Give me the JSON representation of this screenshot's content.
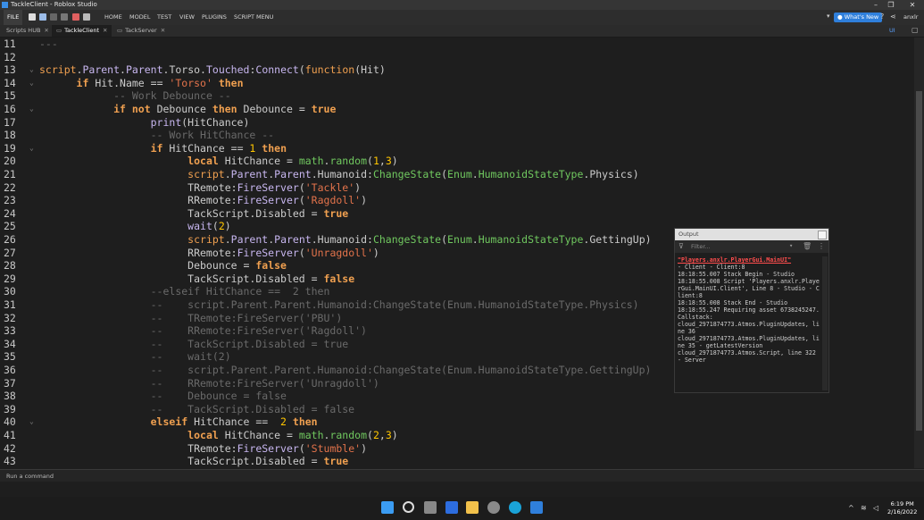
{
  "window": {
    "title": "TackleClient - Roblox Studio"
  },
  "menu": {
    "file": "FILE",
    "items": [
      "HOME",
      "MODEL",
      "TEST",
      "VIEW",
      "PLUGINS",
      "SCRIPT MENU"
    ],
    "whats_new": "What's New",
    "user": "anxlr"
  },
  "tabs": [
    {
      "label": "Scripts HUB",
      "active": false
    },
    {
      "label": "TackleClient",
      "active": true
    },
    {
      "label": "TackServer",
      "active": false
    }
  ],
  "editor": {
    "lines": [
      {
        "n": "11",
        "fold": false,
        "t": [
          [
            "com",
            "---"
          ]
        ]
      },
      {
        "n": "12",
        "fold": false,
        "t": []
      },
      {
        "n": "13",
        "fold": true,
        "t": [
          [
            "kw2",
            "script"
          ],
          [
            "def",
            "."
          ],
          [
            "call",
            "Parent"
          ],
          [
            "def",
            "."
          ],
          [
            "call",
            "Parent"
          ],
          [
            "def",
            ".Torso."
          ],
          [
            "call",
            "Touched"
          ],
          [
            "def",
            ":"
          ],
          [
            "call",
            "Connect"
          ],
          [
            "def",
            "("
          ],
          [
            "kw2",
            "function"
          ],
          [
            "def",
            "(Hit)"
          ]
        ]
      },
      {
        "n": "14",
        "fold": true,
        "t": [
          [
            "def",
            "      "
          ],
          [
            "kw",
            "if"
          ],
          [
            "def",
            " Hit.Name == "
          ],
          [
            "str",
            "'Torso'"
          ],
          [
            "def",
            " "
          ],
          [
            "kw",
            "then"
          ]
        ]
      },
      {
        "n": "15",
        "fold": false,
        "t": [
          [
            "def",
            "            "
          ],
          [
            "com",
            "-- Work Debounce --"
          ]
        ]
      },
      {
        "n": "16",
        "fold": true,
        "t": [
          [
            "def",
            "            "
          ],
          [
            "kw",
            "if not"
          ],
          [
            "def",
            " Debounce "
          ],
          [
            "kw",
            "then"
          ],
          [
            "def",
            " Debounce = "
          ],
          [
            "kw",
            "true"
          ]
        ]
      },
      {
        "n": "17",
        "fold": false,
        "t": [
          [
            "def",
            "                  "
          ],
          [
            "call",
            "print"
          ],
          [
            "def",
            "(HitChance)"
          ]
        ]
      },
      {
        "n": "18",
        "fold": false,
        "t": [
          [
            "def",
            "                  "
          ],
          [
            "com",
            "-- Work HitChance --"
          ]
        ]
      },
      {
        "n": "19",
        "fold": true,
        "t": [
          [
            "def",
            "                  "
          ],
          [
            "kw",
            "if"
          ],
          [
            "def",
            " HitChance == "
          ],
          [
            "num",
            "1"
          ],
          [
            "def",
            " "
          ],
          [
            "kw",
            "then"
          ]
        ]
      },
      {
        "n": "20",
        "fold": false,
        "t": [
          [
            "def",
            "                        "
          ],
          [
            "kw",
            "local"
          ],
          [
            "def",
            " HitChance = "
          ],
          [
            "lib",
            "math"
          ],
          [
            "def",
            "."
          ],
          [
            "lib",
            "random"
          ],
          [
            "def",
            "("
          ],
          [
            "num",
            "1"
          ],
          [
            "def",
            ","
          ],
          [
            "num",
            "3"
          ],
          [
            "def",
            ")"
          ]
        ]
      },
      {
        "n": "21",
        "fold": false,
        "t": [
          [
            "def",
            "                        "
          ],
          [
            "kw2",
            "script"
          ],
          [
            "def",
            "."
          ],
          [
            "call",
            "Parent"
          ],
          [
            "def",
            "."
          ],
          [
            "call",
            "Parent"
          ],
          [
            "def",
            ".Humanoid:"
          ],
          [
            "lib",
            "ChangeState"
          ],
          [
            "def",
            "("
          ],
          [
            "lib",
            "Enum"
          ],
          [
            "def",
            "."
          ],
          [
            "lib",
            "HumanoidStateType"
          ],
          [
            "def",
            ".Physics)"
          ]
        ]
      },
      {
        "n": "22",
        "fold": false,
        "t": [
          [
            "def",
            "                        TRemote:"
          ],
          [
            "call",
            "FireServer"
          ],
          [
            "def",
            "("
          ],
          [
            "str",
            "'Tackle'"
          ],
          [
            "def",
            ")"
          ]
        ]
      },
      {
        "n": "23",
        "fold": false,
        "t": [
          [
            "def",
            "                        RRemote:"
          ],
          [
            "call",
            "FireServer"
          ],
          [
            "def",
            "("
          ],
          [
            "str",
            "'Ragdoll'"
          ],
          [
            "def",
            ")"
          ]
        ]
      },
      {
        "n": "24",
        "fold": false,
        "t": [
          [
            "def",
            "                        TackScript.Disabled = "
          ],
          [
            "kw",
            "true"
          ]
        ]
      },
      {
        "n": "25",
        "fold": false,
        "t": [
          [
            "def",
            "                        "
          ],
          [
            "call",
            "wait"
          ],
          [
            "def",
            "("
          ],
          [
            "num",
            "2"
          ],
          [
            "def",
            ")"
          ]
        ]
      },
      {
        "n": "26",
        "fold": false,
        "t": [
          [
            "def",
            "                        "
          ],
          [
            "kw2",
            "script"
          ],
          [
            "def",
            "."
          ],
          [
            "call",
            "Parent"
          ],
          [
            "def",
            "."
          ],
          [
            "call",
            "Parent"
          ],
          [
            "def",
            ".Humanoid:"
          ],
          [
            "lib",
            "ChangeState"
          ],
          [
            "def",
            "("
          ],
          [
            "lib",
            "Enum"
          ],
          [
            "def",
            "."
          ],
          [
            "lib",
            "HumanoidStateType"
          ],
          [
            "def",
            ".GettingUp)"
          ]
        ]
      },
      {
        "n": "27",
        "fold": false,
        "t": [
          [
            "def",
            "                        RRemote:"
          ],
          [
            "call",
            "FireServer"
          ],
          [
            "def",
            "("
          ],
          [
            "str",
            "'Unragdoll'"
          ],
          [
            "def",
            ")"
          ]
        ]
      },
      {
        "n": "28",
        "fold": false,
        "t": [
          [
            "def",
            "                        Debounce = "
          ],
          [
            "kw",
            "false"
          ]
        ]
      },
      {
        "n": "29",
        "fold": false,
        "t": [
          [
            "def",
            "                        TackScript.Disabled = "
          ],
          [
            "kw",
            "false"
          ]
        ]
      },
      {
        "n": "30",
        "fold": false,
        "t": [
          [
            "def",
            "                  "
          ],
          [
            "com",
            "--elseif HitChance ==  2 then"
          ]
        ]
      },
      {
        "n": "31",
        "fold": false,
        "t": [
          [
            "def",
            "                  "
          ],
          [
            "com",
            "--    script.Parent.Parent.Humanoid:ChangeState(Enum.HumanoidStateType.Physics)"
          ]
        ]
      },
      {
        "n": "32",
        "fold": false,
        "t": [
          [
            "def",
            "                  "
          ],
          [
            "com",
            "--    TRemote:FireServer('PBU')"
          ]
        ]
      },
      {
        "n": "33",
        "fold": false,
        "t": [
          [
            "def",
            "                  "
          ],
          [
            "com",
            "--    RRemote:FireServer('Ragdoll')"
          ]
        ]
      },
      {
        "n": "34",
        "fold": false,
        "t": [
          [
            "def",
            "                  "
          ],
          [
            "com",
            "--    TackScript.Disabled = true"
          ]
        ]
      },
      {
        "n": "35",
        "fold": false,
        "t": [
          [
            "def",
            "                  "
          ],
          [
            "com",
            "--    wait(2)"
          ]
        ]
      },
      {
        "n": "36",
        "fold": false,
        "t": [
          [
            "def",
            "                  "
          ],
          [
            "com",
            "--    script.Parent.Parent.Humanoid:ChangeState(Enum.HumanoidStateType.GettingUp)"
          ]
        ]
      },
      {
        "n": "37",
        "fold": false,
        "t": [
          [
            "def",
            "                  "
          ],
          [
            "com",
            "--    RRemote:FireServer('Unragdoll')"
          ]
        ]
      },
      {
        "n": "38",
        "fold": false,
        "t": [
          [
            "def",
            "                  "
          ],
          [
            "com",
            "--    Debounce = false"
          ]
        ]
      },
      {
        "n": "39",
        "fold": false,
        "t": [
          [
            "def",
            "                  "
          ],
          [
            "com",
            "--    TackScript.Disabled = false"
          ]
        ]
      },
      {
        "n": "40",
        "fold": true,
        "t": [
          [
            "def",
            "                  "
          ],
          [
            "kw",
            "elseif"
          ],
          [
            "def",
            " HitChance ==  "
          ],
          [
            "num",
            "2"
          ],
          [
            "def",
            " "
          ],
          [
            "kw",
            "then"
          ]
        ]
      },
      {
        "n": "41",
        "fold": false,
        "t": [
          [
            "def",
            "                        "
          ],
          [
            "kw",
            "local"
          ],
          [
            "def",
            " HitChance = "
          ],
          [
            "lib",
            "math"
          ],
          [
            "def",
            "."
          ],
          [
            "lib",
            "random"
          ],
          [
            "def",
            "("
          ],
          [
            "num",
            "2"
          ],
          [
            "def",
            ","
          ],
          [
            "num",
            "3"
          ],
          [
            "def",
            ")"
          ]
        ]
      },
      {
        "n": "42",
        "fold": false,
        "t": [
          [
            "def",
            "                        TRemote:"
          ],
          [
            "call",
            "FireServer"
          ],
          [
            "def",
            "("
          ],
          [
            "str",
            "'Stumble'"
          ],
          [
            "def",
            ")"
          ]
        ]
      },
      {
        "n": "43",
        "fold": false,
        "t": [
          [
            "def",
            "                        TackScript.Disabled = "
          ],
          [
            "kw",
            "true"
          ]
        ]
      }
    ]
  },
  "output": {
    "title": "Output",
    "filter_placeholder": "Filter...",
    "lines": [
      {
        "style": "err",
        "text": "\"Players.anxlr.PlayerGui.MainUI\""
      },
      {
        "style": "",
        "text": " -  Client - Client:8"
      },
      {
        "style": "",
        "text": "  18:18:55.007  Stack Begin  -  Studio"
      },
      {
        "style": "",
        "text": "  18:18:55.008  Script 'Players.anxlr.PlayerGui.MainUI.Client', Line 8  -  Studio - Client:8"
      },
      {
        "style": "",
        "text": "  18:18:55.008  Stack End  -  Studio"
      },
      {
        "style": "",
        "text": "  18:18:55.247  Requiring asset 6738245247."
      },
      {
        "style": "",
        "text": "Callstack:"
      },
      {
        "style": "",
        "text": "cloud_2971874773.Atmos.PluginUpdates, line 36"
      },
      {
        "style": "",
        "text": "cloud_2971874773.Atmos.PluginUpdates, line 35 - getLatestVersion"
      },
      {
        "style": "",
        "text": "cloud_2971874773.Atmos.Script, line 322"
      },
      {
        "style": "",
        "text": "  -  Server"
      }
    ]
  },
  "command_bar": {
    "placeholder": "Run a command"
  },
  "taskbar": {
    "time": "6:19 PM",
    "date": "2/16/2022"
  },
  "colors": {
    "accent": "#2f7fdb",
    "string": "#e3734b",
    "keyword": "#f0a050",
    "number": "#ffc600",
    "comment": "#6a6a6a",
    "builtin": "#70c85f"
  }
}
